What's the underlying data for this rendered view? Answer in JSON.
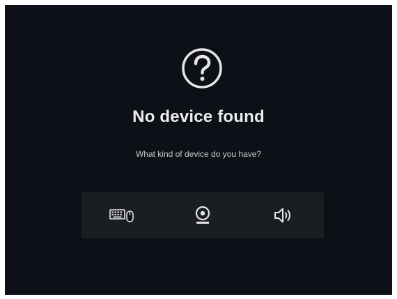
{
  "empty_state": {
    "icon": "help-circle-icon",
    "title": "No device found",
    "prompt": "What kind of device do you have?"
  },
  "device_options": [
    {
      "name": "keyboard-mouse",
      "icon": "keyboard-mouse-icon"
    },
    {
      "name": "webcam",
      "icon": "webcam-icon"
    },
    {
      "name": "speaker",
      "icon": "speaker-icon"
    }
  ],
  "colors": {
    "background": "#0d1117",
    "panel": "#1a1d22",
    "text": "#ececec",
    "muted_text": "#c8c8c8"
  }
}
